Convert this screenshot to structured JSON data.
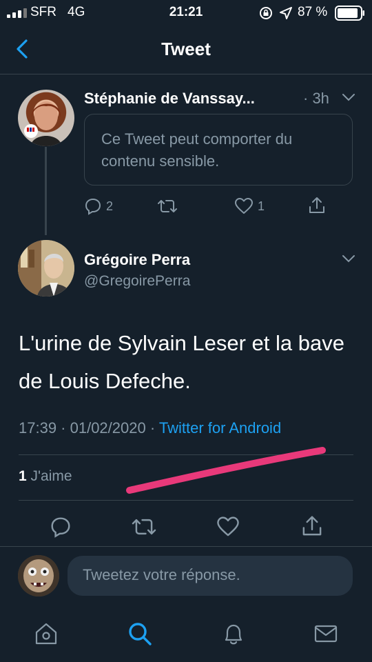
{
  "status_bar": {
    "carrier": "SFR",
    "network": "4G",
    "time": "21:21",
    "battery": "87 %"
  },
  "nav": {
    "title": "Tweet"
  },
  "parent_tweet": {
    "author_name": "Stéphanie de Vanssay...",
    "time_ago": "· 3h",
    "sensitive_notice": "Ce Tweet peut comporter du contenu sensible.",
    "reply_count": "2",
    "like_count": "1"
  },
  "main_tweet": {
    "author_name": "Grégoire Perra",
    "handle": "@GregoirePerra",
    "text": "L'urine de Sylvain Leser et la bave de Louis Defeche.",
    "timestamp": "17:39 · 01/02/2020 · ",
    "client": "Twitter for Android",
    "likes_count": "1",
    "likes_label": " J'aime"
  },
  "reply": {
    "placeholder": "Tweetez votre réponse."
  },
  "tab_bar": {
    "tabs": [
      "home-icon",
      "search-icon",
      "notifications-icon",
      "messages-icon"
    ],
    "active": "search-icon"
  },
  "colors": {
    "background": "#15202b",
    "accent": "#1da1f2",
    "muted": "#8899a6",
    "divider": "#38444d",
    "annotation": "#e8397a"
  }
}
